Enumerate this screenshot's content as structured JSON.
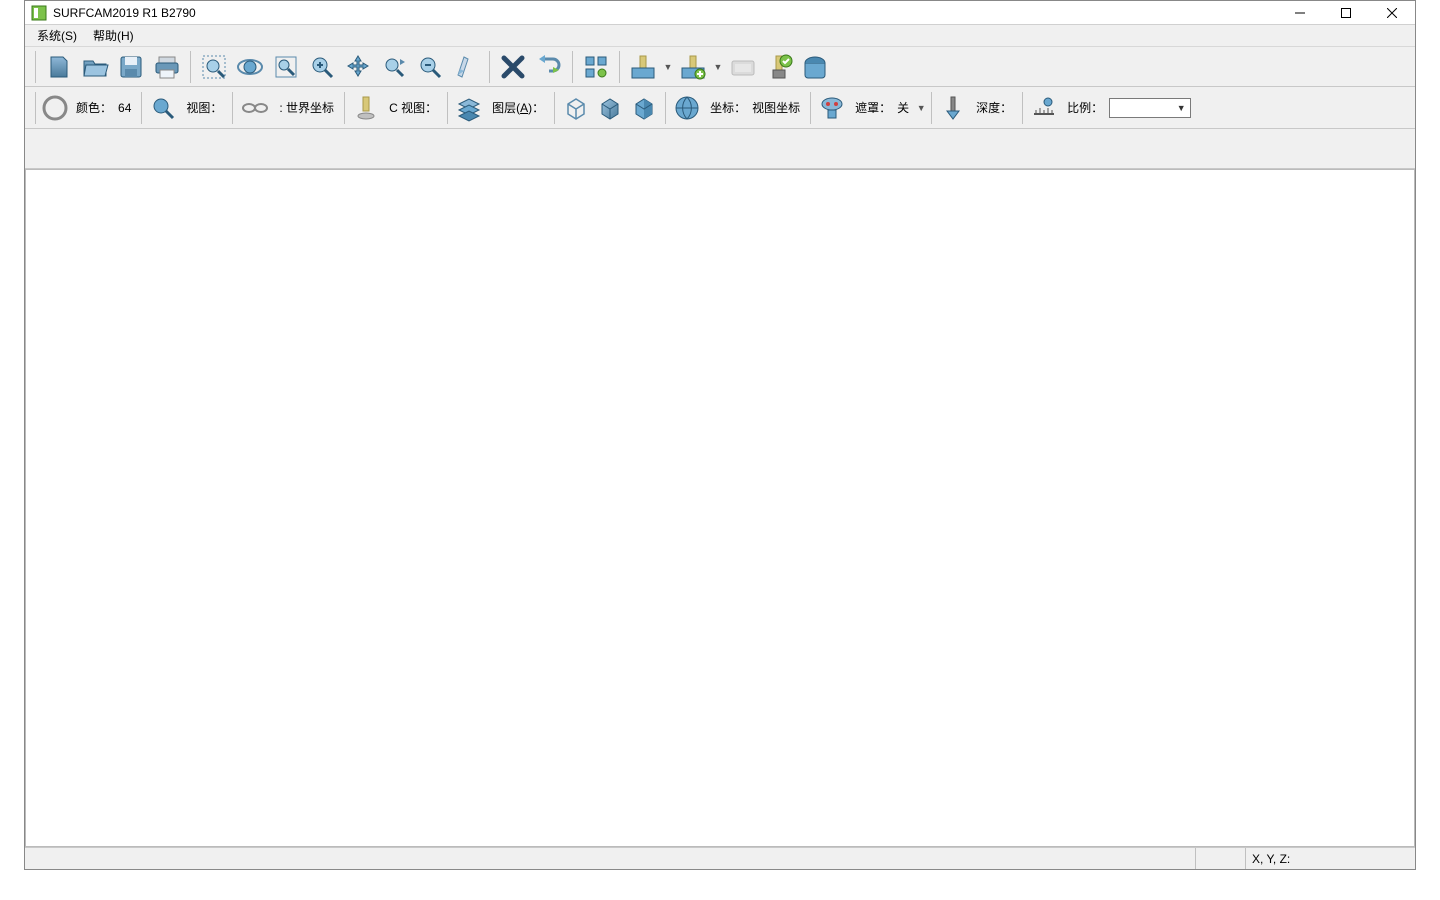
{
  "title": "SURFCAM2019 R1   B2790",
  "menus": {
    "system": "系统(S)",
    "help": "帮助(H)"
  },
  "toolbar2": {
    "color_label": "颜色：",
    "color_value": "64",
    "view_label": "视图：",
    "world_label": ": 世界坐标",
    "cview_label": "C 视图：",
    "layer_label": "图层(A)：",
    "coord_label": "坐标：",
    "coord_value": "视图坐标",
    "mask_label": "遮罩：",
    "mask_value": "关",
    "depth_label": "深度：",
    "scale_label": "比例："
  },
  "status": {
    "xyz": "X, Y, Z:"
  }
}
